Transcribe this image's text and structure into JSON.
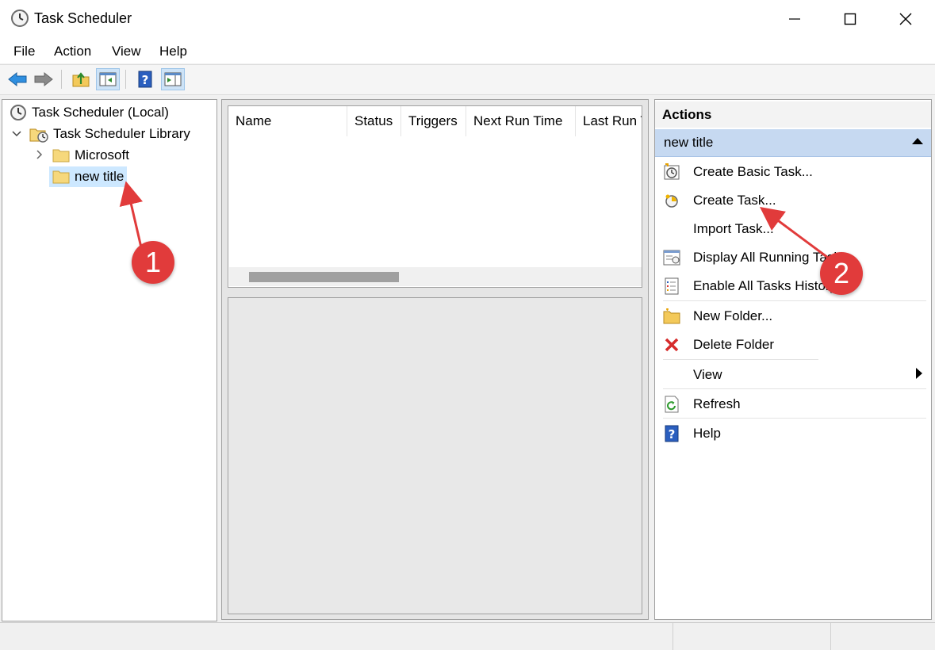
{
  "window": {
    "title": "Task Scheduler"
  },
  "menu": {
    "file": "File",
    "action": "Action",
    "view": "View",
    "help": "Help"
  },
  "tree": {
    "root": "Task Scheduler (Local)",
    "library": "Task Scheduler Library",
    "microsoft": "Microsoft",
    "new_title": "new title"
  },
  "task_list": {
    "columns": [
      "Name",
      "Status",
      "Triggers",
      "Next Run Time",
      "Last Run T"
    ]
  },
  "actions": {
    "header": "Actions",
    "section": "new title",
    "items": [
      {
        "label": "Create Basic Task...",
        "icon": "create-basic-task-icon"
      },
      {
        "label": "Create Task...",
        "icon": "create-task-icon"
      },
      {
        "label": "Import Task...",
        "icon": ""
      },
      {
        "label": "Display All Running Tasks",
        "icon": "running-tasks-icon"
      },
      {
        "label": "Enable All Tasks History",
        "icon": "tasks-history-icon"
      },
      {
        "label": "New Folder...",
        "icon": "new-folder-icon"
      },
      {
        "label": "Delete Folder",
        "icon": "delete-icon"
      },
      {
        "label": "View",
        "icon": ""
      },
      {
        "label": "Refresh",
        "icon": "refresh-icon"
      },
      {
        "label": "Help",
        "icon": "help-icon"
      }
    ]
  },
  "callouts": {
    "one": "1",
    "two": "2"
  },
  "colors": {
    "accent": "#e13b3b",
    "selection": "#cde8ff",
    "section_bg": "#c6d9f1"
  }
}
